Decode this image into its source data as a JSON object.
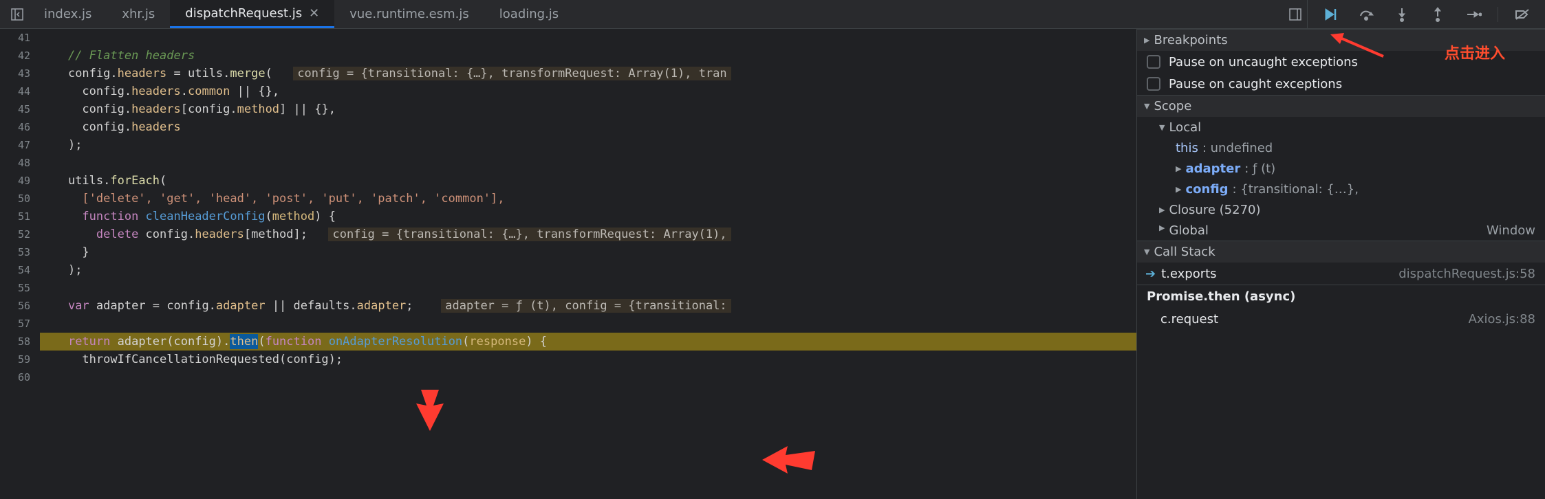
{
  "tabs": {
    "items": [
      {
        "label": "index.js"
      },
      {
        "label": "xhr.js"
      },
      {
        "label": "dispatchRequest.js",
        "active": true
      },
      {
        "label": "vue.runtime.esm.js"
      },
      {
        "label": "loading.js"
      }
    ]
  },
  "gutter": [
    "41",
    "42",
    "43",
    "44",
    "45",
    "46",
    "47",
    "48",
    "49",
    "50",
    "51",
    "52",
    "53",
    "54",
    "55",
    "56",
    "57",
    "58",
    "59",
    "60"
  ],
  "code": {
    "l42_comment": "// Flatten headers",
    "l43_a": "config.",
    "l43_b": "headers",
    "l43_c": " = utils.",
    "l43_d": "merge",
    "l43_e": "(",
    "l43_hint": "config = {transitional: {…}, transformRequest: Array(1), tran",
    "l44_a": "config.",
    "l44_b": "headers",
    "l44_c": ".",
    "l44_d": "common",
    "l44_e": " || {},",
    "l45_a": "config.",
    "l45_b": "headers",
    "l45_c": "[config.",
    "l45_d": "method",
    "l45_e": "] || {},",
    "l46_a": "config.",
    "l46_b": "headers",
    "l47": ");",
    "l49_a": "utils.",
    "l49_b": "forEach",
    "l49_c": "(",
    "l50_arr": "['delete', 'get', 'head', 'post', 'put', 'patch', 'common'],",
    "l51_a": "function",
    "l51_b": " cleanHeaderConfig",
    "l51_c": "(",
    "l51_d": "method",
    "l51_e": ") {",
    "l52_a": "delete",
    "l52_b": " config.",
    "l52_c": "headers",
    "l52_d": "[method];",
    "l52_hint": "config = {transitional: {…}, transformRequest: Array(1),",
    "l53": "}",
    "l54": ");",
    "l56_a": "var",
    "l56_b": " adapter",
    "l56_c": " = config.",
    "l56_d": "adapter",
    "l56_e": " || defaults.",
    "l56_f": "adapter",
    "l56_g": ";",
    "l56_hint": "adapter = ƒ (t), config = {transitional:",
    "l58_a": "return",
    "l58_b": " adapter(config).",
    "l58_c": "then",
    "l58_d": "(",
    "l58_e": "function",
    "l58_f": " onAdapterResolution",
    "l58_g": "(",
    "l58_h": "response",
    "l58_i": ") {",
    "l59": "throwIfCancellationRequested(config);"
  },
  "annotations": {
    "main": "点击进入"
  },
  "sidebar": {
    "breakpoints": {
      "title": "Breakpoints",
      "pauseUncaught": "Pause on uncaught exceptions",
      "pauseCaught": "Pause on caught exceptions"
    },
    "scope": {
      "title": "Scope",
      "local": "Local",
      "this_key": "this",
      "this_val": ": undefined",
      "adapter_key": "adapter",
      "adapter_val": ": ƒ (t)",
      "config_key": "config",
      "config_val": ": {transitional: {…},",
      "closure": "Closure (5270)",
      "global": "Global",
      "global_val": "Window"
    },
    "callstack": {
      "title": "Call Stack",
      "rows": [
        {
          "fn": "t.exports",
          "loc": "dispatchRequest.js:58",
          "current": true
        },
        {
          "fn": "Promise.then (async)",
          "sep": true
        },
        {
          "fn": "c.request",
          "loc": "Axios.js:88"
        }
      ]
    }
  }
}
